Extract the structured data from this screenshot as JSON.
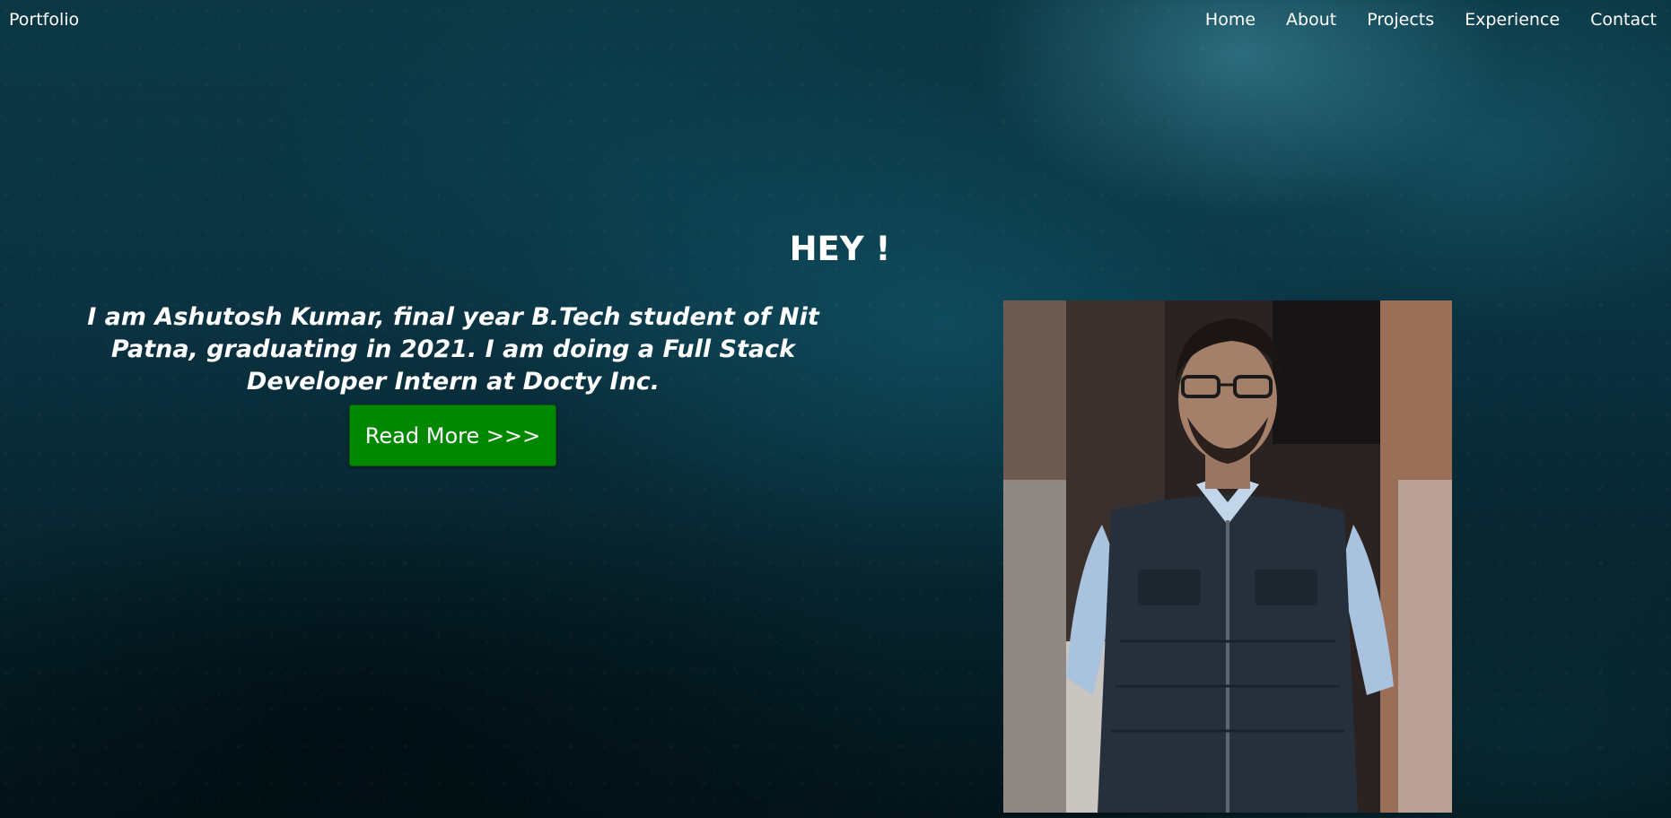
{
  "navbar": {
    "brand": "Portfolio",
    "links": [
      {
        "label": "Home"
      },
      {
        "label": "About"
      },
      {
        "label": "Projects"
      },
      {
        "label": "Experience"
      },
      {
        "label": "Contact"
      }
    ]
  },
  "hero": {
    "greeting": "HEY !",
    "intro": "I am Ashutosh Kumar, final year B.Tech student of Nit Patna, graduating in 2021. I am doing a Full Stack Developer Intern at Docty Inc.",
    "read_more_label": "Read More >>>"
  },
  "colors": {
    "button": "#008800",
    "background": "#0a3140",
    "text": "#ffffff"
  }
}
